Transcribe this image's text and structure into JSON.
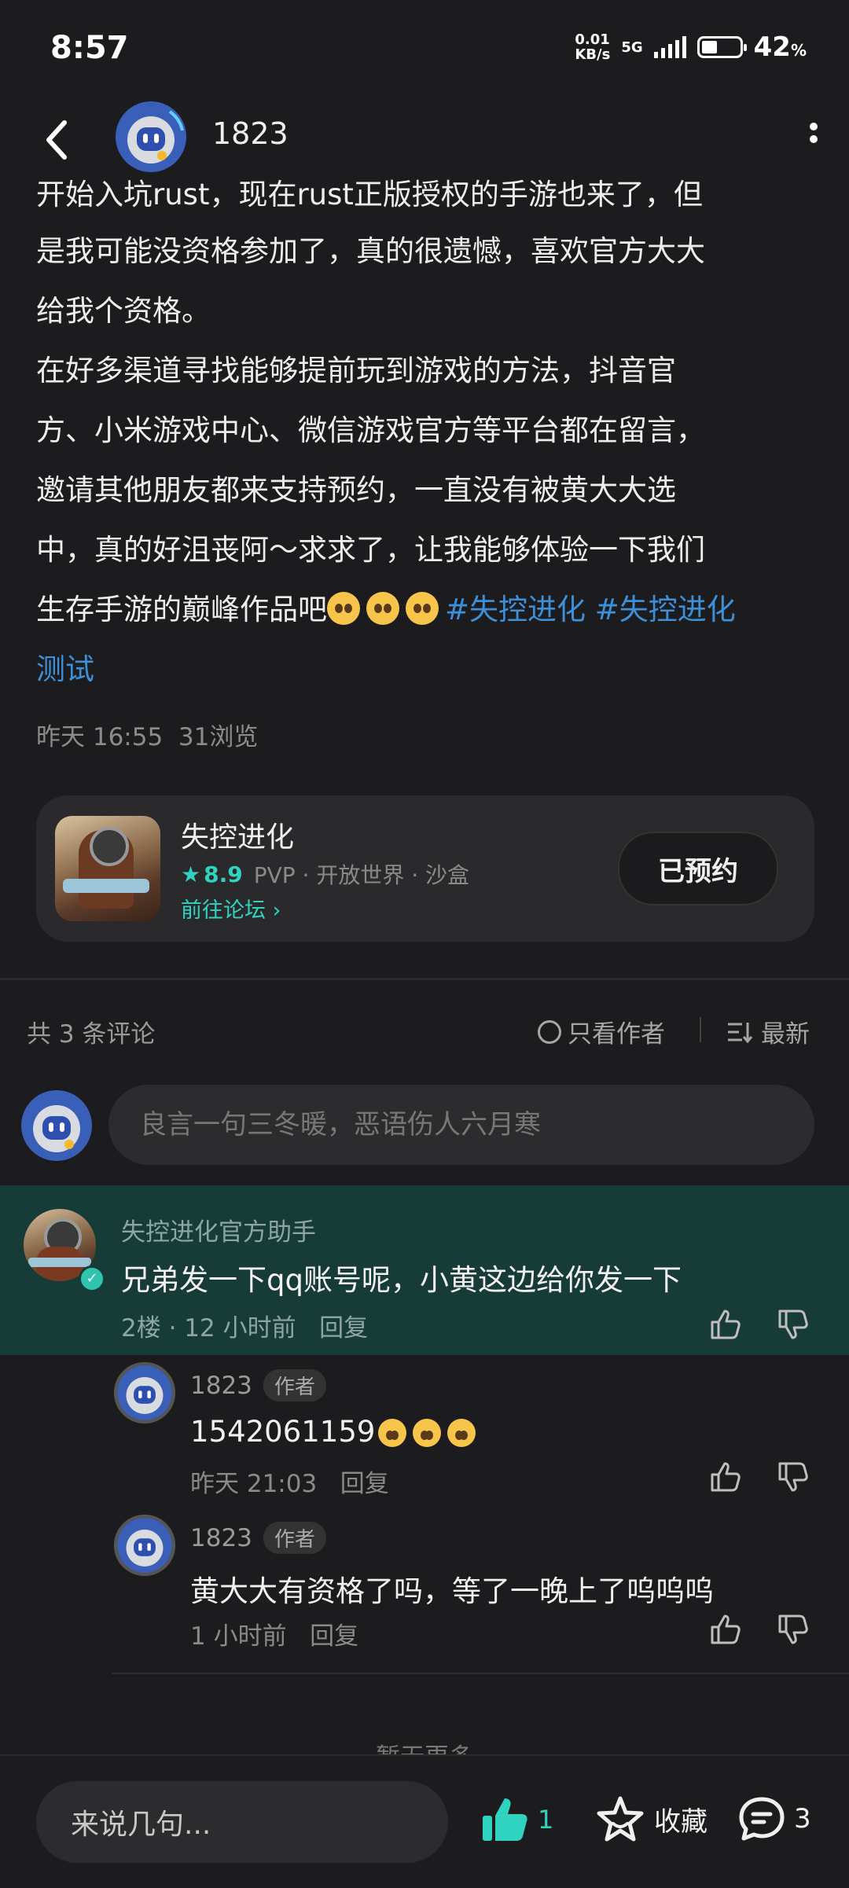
{
  "status_bar": {
    "time": "8:57",
    "speed_value": "0.01",
    "speed_unit": "KB/s",
    "network": "5G",
    "battery_pct": "42",
    "battery_unit": "%"
  },
  "header": {
    "username": "1823"
  },
  "post": {
    "cut_line": "开始入坑rust，现在rust正版授权的手游也来了，但",
    "line2": "是我可能没资格参加了，真的很遗憾，喜欢官方大大",
    "line3": "给我个资格。",
    "para2_line1": "在好多渠道寻找能够提前玩到游戏的方法，抖音官",
    "para2_line2": "方、小米游戏中心、微信游戏官方等平台都在留言，",
    "para2_line3": "邀请其他朋友都来支持预约，一直没有被黄大大选",
    "para2_line4": "中，真的好沮丧阿～求求了，让我能够体验一下我们",
    "para2_line5": "生存手游的巅峰作品吧",
    "tag1": "#失控进化",
    "tag2a": "#失控进化",
    "tag2b": "测试",
    "meta_time": "昨天 16:55",
    "meta_views": "31浏览"
  },
  "game_card": {
    "name": "失控进化",
    "score": "8.9",
    "tags": "PVP · 开放世界 · 沙盒",
    "forum_link": "前往论坛",
    "reserve_label": "已预约"
  },
  "comments": {
    "count_label": "共 3 条评论",
    "only_author": "只看作者",
    "sort_label": "最新",
    "input_placeholder": "良言一句三冬暖，恶语伤人六月寒",
    "highlight": {
      "name": "失控进化官方助手",
      "text": "兄弟发一下qq账号呢，小黄这边给你发一下",
      "floor": "2楼",
      "time": "12 小时前",
      "reply": "回复"
    },
    "replies": [
      {
        "name": "1823",
        "badge": "作者",
        "text": "1542061159",
        "time": "昨天 21:03",
        "reply": "回复"
      },
      {
        "name": "1823",
        "badge": "作者",
        "text": "黄大大有资格了吗，等了一晚上了呜呜呜",
        "time": "1 小时前",
        "reply": "回复"
      }
    ],
    "no_more": "暂无更多"
  },
  "bottom_bar": {
    "input_label": "来说几句...",
    "like_count": "1",
    "favorite_label": "收藏",
    "comment_count": "3"
  },
  "colors": {
    "accent": "#2fd3bf",
    "link": "#3d8fd8",
    "highlight_bg": "#173b36",
    "background": "#1c1c1e"
  }
}
